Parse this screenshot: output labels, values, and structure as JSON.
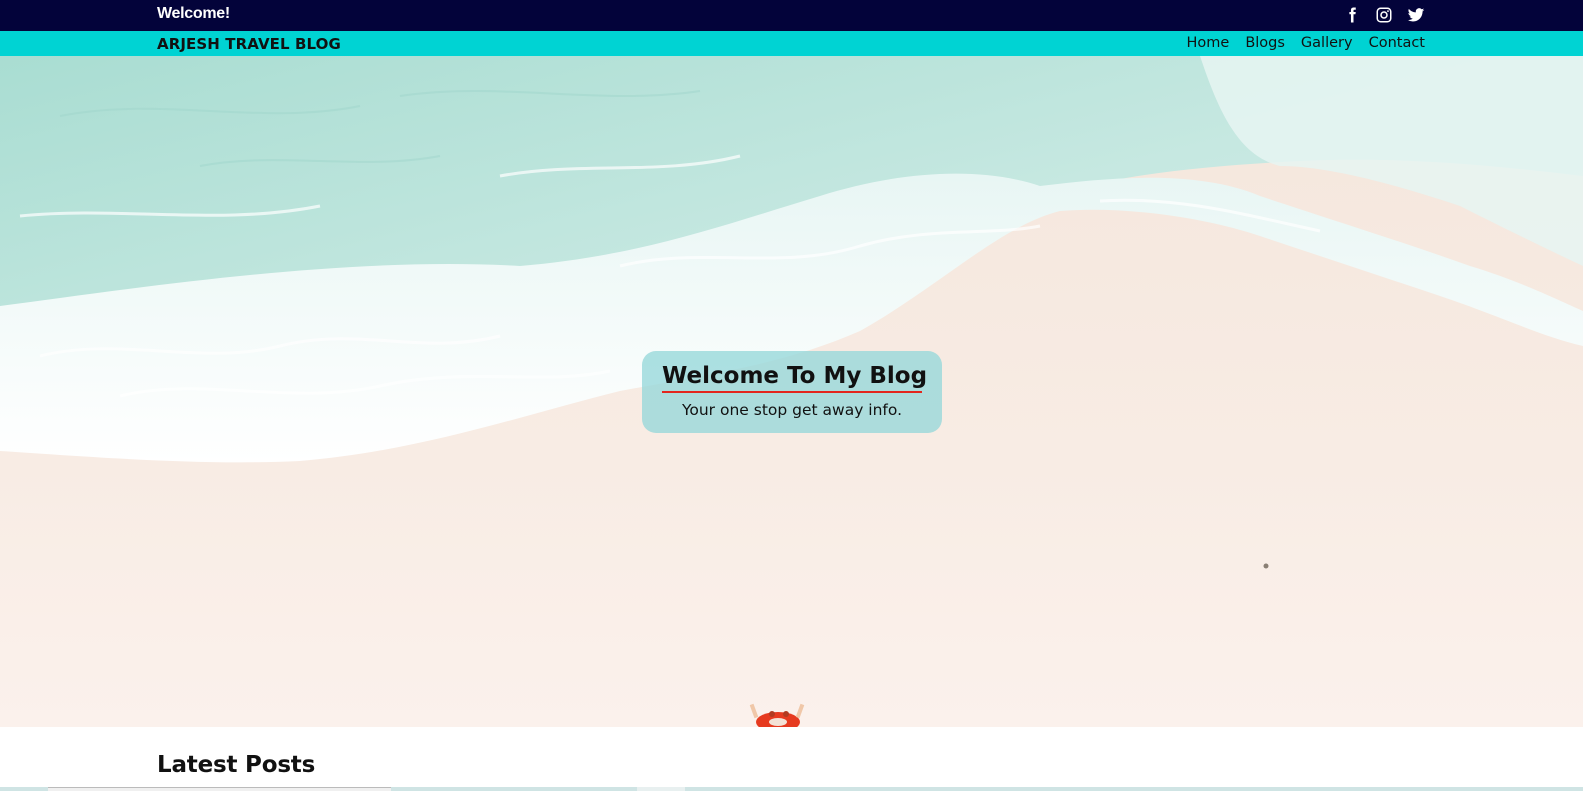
{
  "topbar": {
    "welcome": "Welcome!",
    "social": [
      {
        "name": "facebook-icon"
      },
      {
        "name": "instagram-icon"
      },
      {
        "name": "twitter-icon"
      }
    ]
  },
  "navbar": {
    "brand": "ARJESH TRAVEL BLOG",
    "links": [
      "Home",
      "Blogs",
      "Gallery",
      "Contact"
    ]
  },
  "hero": {
    "title": "Welcome To My Blog",
    "subtitle": "Your one stop get away info."
  },
  "posts": {
    "title": "Latest Posts"
  },
  "colors": {
    "topbar_bg": "#03033a",
    "navbar_bg": "#00d3d3",
    "underline": "#e3261e"
  }
}
